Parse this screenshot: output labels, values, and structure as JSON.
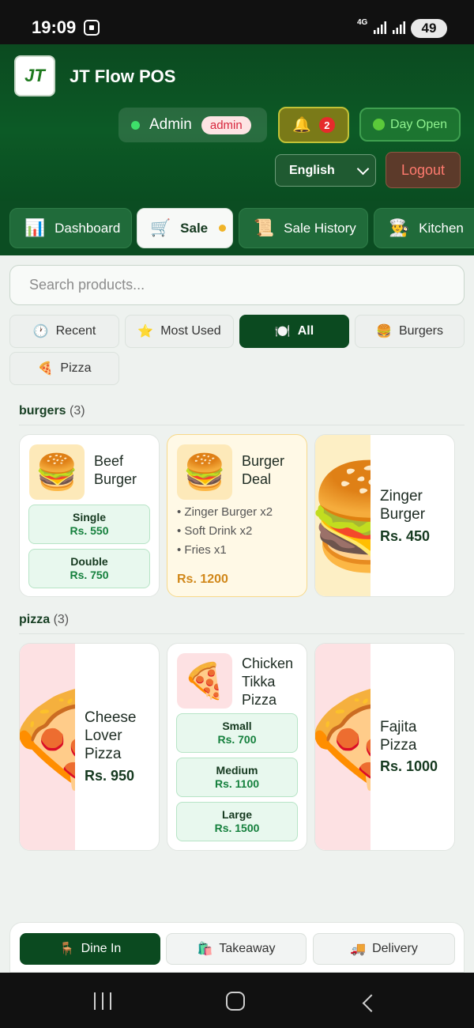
{
  "status_bar": {
    "time": "19:09",
    "network": "4G",
    "battery": "49"
  },
  "header": {
    "logo_text": "JT",
    "app_title": "JT Flow POS"
  },
  "user": {
    "name": "Admin",
    "role": "admin"
  },
  "notifications": {
    "count": "2"
  },
  "day_status": {
    "label": "Day Open"
  },
  "language": {
    "selected": "English"
  },
  "logout": {
    "label": "Logout"
  },
  "nav_tabs": [
    {
      "label": "Dashboard",
      "icon": "chart-icon"
    },
    {
      "label": "Sale",
      "icon": "cart-icon",
      "active": true
    },
    {
      "label": "Sale History",
      "icon": "scroll-icon"
    },
    {
      "label": "Kitchen",
      "icon": "chef-icon"
    }
  ],
  "search": {
    "placeholder": "Search products..."
  },
  "categories": [
    {
      "label": "Recent",
      "icon": "clock-icon"
    },
    {
      "label": "Most Used",
      "icon": "star-icon"
    },
    {
      "label": "All",
      "icon": "plate-icon",
      "active": true
    },
    {
      "label": "Burgers",
      "icon": "burger-icon"
    },
    {
      "label": "Pizza",
      "icon": "pizza-icon"
    }
  ],
  "sections": {
    "burgers": {
      "title": "burgers",
      "count": "(3)",
      "products": [
        {
          "name": "Beef Burger",
          "icon": "burger-icon",
          "variants": [
            {
              "name": "Single",
              "price": "Rs. 550"
            },
            {
              "name": "Double",
              "price": "Rs. 750"
            }
          ]
        },
        {
          "name": "Burger Deal",
          "icon": "burger-icon",
          "items": [
            "• Zinger Burger x2",
            "• Soft Drink x2",
            "• Fries x1"
          ],
          "price": "Rs. 1200"
        },
        {
          "name": "Zinger Burger",
          "icon": "burger-icon",
          "price": "Rs. 450"
        }
      ]
    },
    "pizza": {
      "title": "pizza",
      "count": "(3)",
      "products": [
        {
          "name": "Cheese Lover Pizza",
          "icon": "pizza-icon",
          "price": "Rs. 950"
        },
        {
          "name": "Chicken Tikka Pizza",
          "icon": "pizza-icon",
          "variants": [
            {
              "name": "Small",
              "price": "Rs. 700"
            },
            {
              "name": "Medium",
              "price": "Rs. 1100"
            },
            {
              "name": "Large",
              "price": "Rs. 1500"
            }
          ]
        },
        {
          "name": "Fajita Pizza",
          "icon": "pizza-icon",
          "price": "Rs. 1000"
        }
      ]
    }
  },
  "order_types": [
    {
      "label": "Dine In",
      "icon": "chair-icon",
      "active": true
    },
    {
      "label": "Takeaway",
      "icon": "bag-icon"
    },
    {
      "label": "Delivery",
      "icon": "truck-icon"
    }
  ],
  "colors": {
    "brand": "#0b4a20",
    "price_green": "#15803d",
    "deal_price": "#d1881a",
    "logout_text": "#ff7a6e"
  }
}
